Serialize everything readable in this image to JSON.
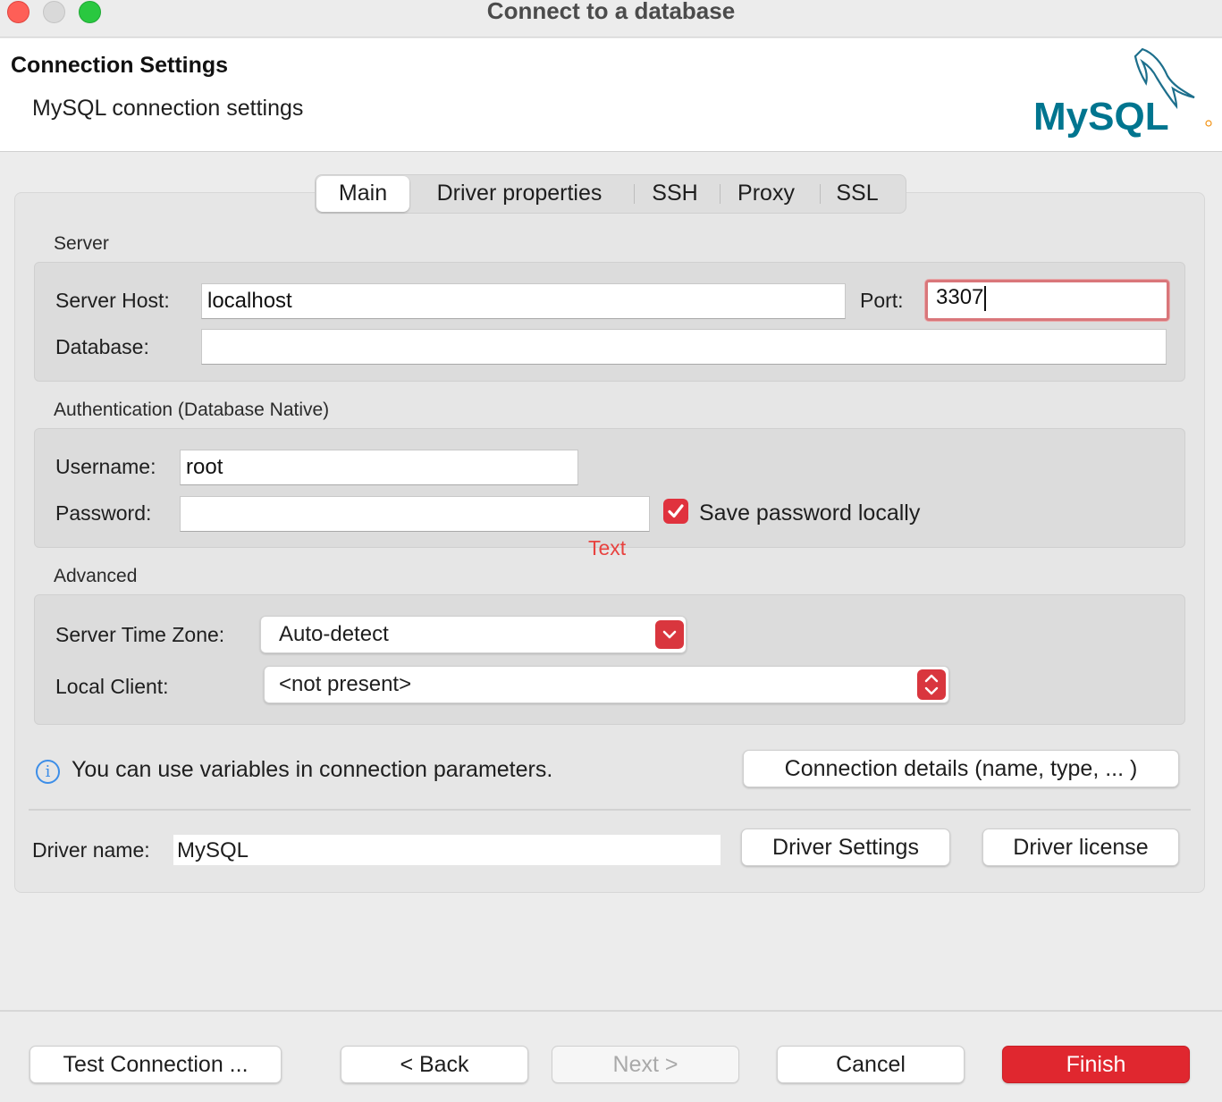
{
  "window": {
    "title": "Connect to a database"
  },
  "header": {
    "title": "Connection Settings",
    "subtitle": "MySQL connection settings",
    "logo_text": "MySQL",
    "logo_colors": {
      "text": "#00758f",
      "dolphin": "#1d6f8c",
      "sql": "#f29111"
    }
  },
  "tabs": [
    {
      "label": "Main",
      "active": true
    },
    {
      "label": "Driver properties",
      "active": false
    },
    {
      "label": "SSH",
      "active": false
    },
    {
      "label": "Proxy",
      "active": false
    },
    {
      "label": "SSL",
      "active": false
    }
  ],
  "server": {
    "section_label": "Server",
    "host_label": "Server Host:",
    "host_value": "localhost",
    "port_label": "Port:",
    "port_value": "3307",
    "database_label": "Database:",
    "database_value": ""
  },
  "auth": {
    "section_label": "Authentication (Database Native)",
    "username_label": "Username:",
    "username_value": "root",
    "password_label": "Password:",
    "password_value": "",
    "save_password_label": "Save password locally",
    "save_password_checked": true,
    "hint_text": "Text"
  },
  "advanced": {
    "section_label": "Advanced",
    "timezone_label": "Server Time Zone:",
    "timezone_value": "Auto-detect",
    "local_client_label": "Local Client:",
    "local_client_value": "<not present>"
  },
  "info": {
    "text": "You can use variables in connection parameters.",
    "connection_details_button": "Connection details (name, type, ... )"
  },
  "driver": {
    "label": "Driver name:",
    "value": "MySQL",
    "settings_button": "Driver Settings",
    "license_button": "Driver license"
  },
  "footer": {
    "test_button": "Test Connection ...",
    "back_button": "< Back",
    "next_button": "Next >",
    "cancel_button": "Cancel",
    "finish_button": "Finish"
  },
  "colors": {
    "accent_red": "#e0272f",
    "focus_ring": "#d9767a",
    "info_blue": "#3d8ee8"
  }
}
